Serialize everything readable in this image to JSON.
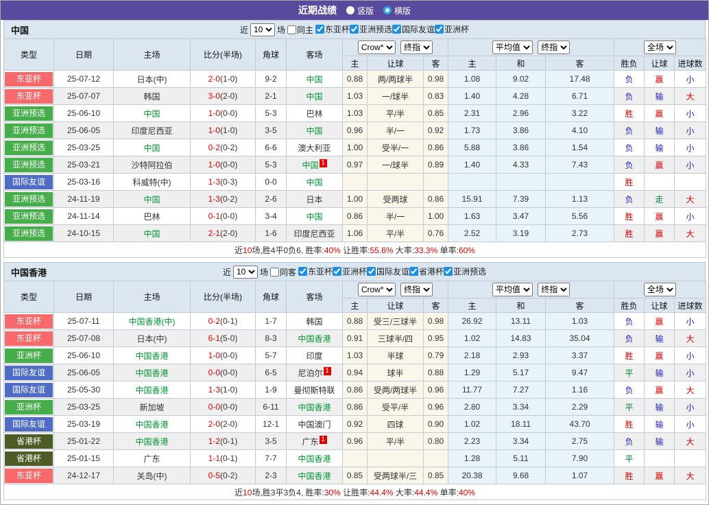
{
  "title_bar": {
    "title": "近期战绩",
    "vertical_label": "竖版",
    "horizontal_label": "横版",
    "selected": "横版"
  },
  "colors": {
    "accent_purple": "#5a4a9d",
    "header_bg": "#dce6f1",
    "team_green": "#009933",
    "score_red": "#e00000",
    "type_badges": {
      "东亚杯": "#f8696b",
      "亚洲预选": "#45ad49",
      "亚洲杯": "#45ad49",
      "国际友谊": "#4f6cc8",
      "省港杯": "#4e5c28"
    },
    "outcome_colors": {
      "胜": "#dd0000",
      "负": "#2323cc",
      "平": "#008833",
      "赢": "#dd0000",
      "输": "#2323cc",
      "走": "#008833",
      "大": "#dd0000",
      "小": "#2323cc"
    }
  },
  "header_labels": {
    "left": [
      "类型",
      "日期",
      "主场",
      "比分(半场)",
      "角球",
      "客场"
    ],
    "group1": [
      "Crow*",
      "终指"
    ],
    "group2": [
      "平均值",
      "终指"
    ],
    "group3": [
      "全场"
    ],
    "sub": [
      "主",
      "让球",
      "客",
      "主",
      "和",
      "客",
      "胜负",
      "让球",
      "进球数"
    ]
  },
  "sections": [
    {
      "name": "中国",
      "filter": {
        "near_label": "近",
        "count": "10",
        "games_label": "场",
        "same_label": "同主",
        "same_checked": false,
        "competitions": [
          "东亚杯",
          "亚洲预选",
          "国际友谊",
          "亚洲杯"
        ]
      },
      "rows": [
        {
          "type": "东亚杯",
          "date": "25-07-12",
          "home": "日本(中)",
          "home_green": false,
          "ft": "2-0",
          "ht": "(1-0)",
          "corner": "9-2",
          "away": "中国",
          "away_green": true,
          "away_note": "",
          "odds": [
            "0.88",
            "两/两球半",
            "0.98"
          ],
          "avg": [
            "1.08",
            "9.02",
            "17.48"
          ],
          "outcome": [
            "负",
            "赢",
            "小"
          ]
        },
        {
          "type": "东亚杯",
          "date": "25-07-07",
          "home": "韩国",
          "home_green": false,
          "ft": "3-0",
          "ht": "(2-0)",
          "corner": "2-1",
          "away": "中国",
          "away_green": true,
          "away_note": "",
          "odds": [
            "1.03",
            "一/球半",
            "0.83"
          ],
          "avg": [
            "1.40",
            "4.28",
            "6.71"
          ],
          "outcome": [
            "负",
            "输",
            "大"
          ]
        },
        {
          "type": "亚洲预选",
          "date": "25-06-10",
          "home": "中国",
          "home_green": true,
          "ft": "1-0",
          "ht": "(0-0)",
          "corner": "5-3",
          "away": "巴林",
          "away_green": false,
          "away_note": "",
          "odds": [
            "1.03",
            "平/半",
            "0.85"
          ],
          "avg": [
            "2.31",
            "2.96",
            "3.22"
          ],
          "outcome": [
            "胜",
            "赢",
            "小"
          ]
        },
        {
          "type": "亚洲预选",
          "date": "25-06-05",
          "home": "印度尼西亚",
          "home_green": false,
          "ft": "1-0",
          "ht": "(1-0)",
          "corner": "3-5",
          "away": "中国",
          "away_green": true,
          "away_note": "",
          "odds": [
            "0.96",
            "半/一",
            "0.92"
          ],
          "avg": [
            "1.73",
            "3.86",
            "4.10"
          ],
          "outcome": [
            "负",
            "输",
            "小"
          ]
        },
        {
          "type": "亚洲预选",
          "date": "25-03-25",
          "home": "中国",
          "home_green": true,
          "ft": "0-2",
          "ht": "(0-2)",
          "corner": "6-6",
          "away": "澳大利亚",
          "away_green": false,
          "away_note": "",
          "odds": [
            "1.00",
            "受半/一",
            "0.86"
          ],
          "avg": [
            "5.88",
            "3.86",
            "1.54"
          ],
          "outcome": [
            "负",
            "输",
            "小"
          ]
        },
        {
          "type": "亚洲预选",
          "date": "25-03-21",
          "home": "沙特阿拉伯",
          "home_green": false,
          "ft": "1-0",
          "ht": "(0-0)",
          "corner": "5-3",
          "away": "中国",
          "away_green": true,
          "away_note": "1",
          "odds": [
            "0.97",
            "一/球半",
            "0.89"
          ],
          "avg": [
            "1.40",
            "4.33",
            "7.43"
          ],
          "outcome": [
            "负",
            "赢",
            "小"
          ]
        },
        {
          "type": "国际友谊",
          "date": "25-03-16",
          "home": "科威特(中)",
          "home_green": false,
          "ft": "1-3",
          "ht": "(0-3)",
          "corner": "0-0",
          "away": "中国",
          "away_green": true,
          "away_note": "",
          "odds": [
            "",
            "",
            ""
          ],
          "avg": [
            "",
            "",
            ""
          ],
          "outcome": [
            "胜",
            "",
            ""
          ]
        },
        {
          "type": "亚洲预选",
          "date": "24-11-19",
          "home": "中国",
          "home_green": true,
          "ft": "1-3",
          "ht": "(0-2)",
          "corner": "2-6",
          "away": "日本",
          "away_green": false,
          "away_note": "",
          "odds": [
            "1.00",
            "受两球",
            "0.86"
          ],
          "avg": [
            "15.91",
            "7.39",
            "1.13"
          ],
          "outcome": [
            "负",
            "走",
            "大"
          ]
        },
        {
          "type": "亚洲预选",
          "date": "24-11-14",
          "home": "巴林",
          "home_green": false,
          "ft": "0-1",
          "ht": "(0-0)",
          "corner": "3-4",
          "away": "中国",
          "away_green": true,
          "away_note": "",
          "odds": [
            "0.86",
            "半/一",
            "1.00"
          ],
          "avg": [
            "1.63",
            "3.47",
            "5.56"
          ],
          "outcome": [
            "胜",
            "赢",
            "小"
          ]
        },
        {
          "type": "亚洲预选",
          "date": "24-10-15",
          "home": "中国",
          "home_green": true,
          "ft": "2-1",
          "ht": "(2-0)",
          "corner": "1-6",
          "away": "印度尼西亚",
          "away_green": false,
          "away_note": "",
          "odds": [
            "1.06",
            "平/半",
            "0.76"
          ],
          "avg": [
            "2.52",
            "3.19",
            "2.73"
          ],
          "outcome": [
            "胜",
            "赢",
            "大"
          ]
        }
      ],
      "summary": [
        {
          "t": "近"
        },
        {
          "t": "10",
          "red": true
        },
        {
          "t": "场,胜4平0负6, 胜率:"
        },
        {
          "t": "40%",
          "red": true
        },
        {
          "t": " 让胜率:"
        },
        {
          "t": "55.6%",
          "red": true
        },
        {
          "t": " 大率:"
        },
        {
          "t": "33.3%",
          "red": true
        },
        {
          "t": " 单率:"
        },
        {
          "t": "60%",
          "red": true
        }
      ]
    },
    {
      "name": "中国香港",
      "filter": {
        "near_label": "近",
        "count": "10",
        "games_label": "场",
        "same_label": "同客",
        "same_checked": false,
        "competitions": [
          "东亚杯",
          "亚洲杯",
          "国际友谊",
          "省港杯",
          "亚洲预选"
        ]
      },
      "rows": [
        {
          "type": "东亚杯",
          "date": "25-07-11",
          "home": "中国香港(中)",
          "home_green": true,
          "ft": "0-2",
          "ht": "(0-1)",
          "corner": "1-7",
          "away": "韩国",
          "away_green": false,
          "away_note": "",
          "odds": [
            "0.88",
            "受三/三球半",
            "0.98"
          ],
          "avg": [
            "26.92",
            "13.11",
            "1.03"
          ],
          "outcome": [
            "负",
            "赢",
            "小"
          ]
        },
        {
          "type": "东亚杯",
          "date": "25-07-08",
          "home": "日本(中)",
          "home_green": false,
          "ft": "6-1",
          "ht": "(5-0)",
          "corner": "8-3",
          "away": "中国香港",
          "away_green": true,
          "away_note": "",
          "odds": [
            "0.91",
            "三球半/四",
            "0.95"
          ],
          "avg": [
            "1.02",
            "14.83",
            "35.04"
          ],
          "outcome": [
            "负",
            "输",
            "大"
          ]
        },
        {
          "type": "亚洲杯",
          "date": "25-06-10",
          "home": "中国香港",
          "home_green": true,
          "ft": "1-0",
          "ht": "(0-0)",
          "corner": "5-7",
          "away": "印度",
          "away_green": false,
          "away_note": "",
          "odds": [
            "1.03",
            "半球",
            "0.79"
          ],
          "avg": [
            "2.18",
            "2.93",
            "3.37"
          ],
          "outcome": [
            "胜",
            "赢",
            "小"
          ]
        },
        {
          "type": "国际友谊",
          "date": "25-06-05",
          "home": "中国香港",
          "home_green": true,
          "ft": "0-0",
          "ht": "(0-0)",
          "corner": "6-5",
          "away": "尼泊尔",
          "away_green": false,
          "away_note": "1",
          "odds": [
            "0.94",
            "球半",
            "0.88"
          ],
          "avg": [
            "1.29",
            "5.17",
            "9.47"
          ],
          "outcome": [
            "平",
            "输",
            "小"
          ]
        },
        {
          "type": "国际友谊",
          "date": "25-05-30",
          "home": "中国香港",
          "home_green": true,
          "ft": "1-3",
          "ht": "(1-0)",
          "corner": "1-9",
          "away": "曼彻斯特联",
          "away_green": false,
          "away_note": "",
          "odds": [
            "0.86",
            "受两/两球半",
            "0.96"
          ],
          "avg": [
            "11.77",
            "7.27",
            "1.16"
          ],
          "outcome": [
            "负",
            "赢",
            "大"
          ]
        },
        {
          "type": "亚洲杯",
          "date": "25-03-25",
          "home": "新加坡",
          "home_green": false,
          "ft": "0-0",
          "ht": "(0-0)",
          "corner": "6-11",
          "away": "中国香港",
          "away_green": true,
          "away_note": "",
          "odds": [
            "0.86",
            "受平/半",
            "0.96"
          ],
          "avg": [
            "2.80",
            "3.34",
            "2.29"
          ],
          "outcome": [
            "平",
            "输",
            "小"
          ]
        },
        {
          "type": "国际友谊",
          "date": "25-03-19",
          "home": "中国香港",
          "home_green": true,
          "ft": "2-0",
          "ht": "(2-0)",
          "corner": "12-1",
          "away": "中国澳门",
          "away_green": false,
          "away_note": "",
          "odds": [
            "0.92",
            "四球",
            "0.90"
          ],
          "avg": [
            "1.02",
            "18.11",
            "43.70"
          ],
          "outcome": [
            "胜",
            "输",
            "小"
          ]
        },
        {
          "type": "省港杯",
          "date": "25-01-22",
          "home": "中国香港",
          "home_green": true,
          "ft": "1-2",
          "ht": "(0-1)",
          "corner": "3-5",
          "away": "广东",
          "away_green": false,
          "away_note": "1",
          "odds": [
            "0.96",
            "平/半",
            "0.80"
          ],
          "avg": [
            "2.23",
            "3.34",
            "2.75"
          ],
          "outcome": [
            "负",
            "输",
            "大"
          ]
        },
        {
          "type": "省港杯",
          "date": "25-01-15",
          "home": "广东",
          "home_green": false,
          "ft": "1-1",
          "ht": "(0-1)",
          "corner": "7-7",
          "away": "中国香港",
          "away_green": true,
          "away_note": "",
          "odds": [
            "",
            "",
            ""
          ],
          "avg": [
            "1.28",
            "5.11",
            "7.90"
          ],
          "outcome": [
            "平",
            "",
            ""
          ]
        },
        {
          "type": "东亚杯",
          "date": "24-12-17",
          "home": "关岛(中)",
          "home_green": false,
          "ft": "0-5",
          "ht": "(0-2)",
          "corner": "2-3",
          "away": "中国香港",
          "away_green": true,
          "away_note": "",
          "odds": [
            "0.85",
            "受两球半/三",
            "0.85"
          ],
          "avg": [
            "20.38",
            "9.68",
            "1.07"
          ],
          "outcome": [
            "胜",
            "赢",
            "大"
          ]
        }
      ],
      "summary": [
        {
          "t": "近"
        },
        {
          "t": "10",
          "red": true
        },
        {
          "t": "场,胜3平3负4, 胜率:"
        },
        {
          "t": "30%",
          "red": true
        },
        {
          "t": " 让胜率:"
        },
        {
          "t": "44.4%",
          "red": true
        },
        {
          "t": " 大率:"
        },
        {
          "t": "44.4%",
          "red": true
        },
        {
          "t": " 单率:"
        },
        {
          "t": "40%",
          "red": true
        }
      ]
    }
  ]
}
